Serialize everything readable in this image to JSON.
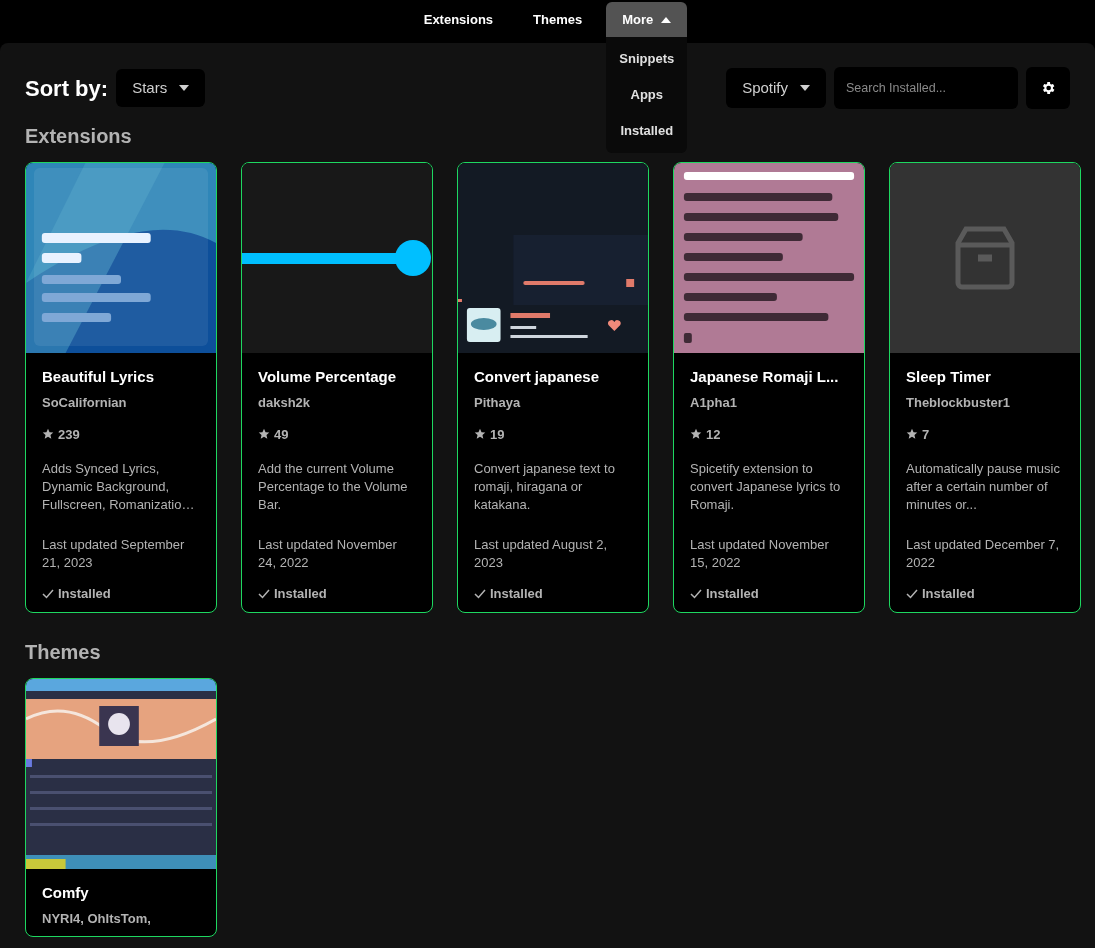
{
  "nav": {
    "tabs": [
      {
        "label": "Extensions",
        "selected": false
      },
      {
        "label": "Themes",
        "selected": false
      },
      {
        "label": "More",
        "selected": true,
        "expanded": true
      }
    ],
    "menu": [
      "Snippets",
      "Apps",
      "Installed"
    ]
  },
  "toolbar": {
    "sort_label": "Sort by:",
    "sort_value": "Stars",
    "repo_value": "Spotify",
    "search": {
      "placeholder": "Search Installed..."
    }
  },
  "sections": [
    {
      "title": "Extensions",
      "cards": [
        {
          "preview": {
            "kind": "lyrics"
          },
          "title": "Beautiful Lyrics",
          "author": "SoCalifornian",
          "star_count": "239",
          "description": "Adds Synced Lyrics, Dynamic Background, Fullscreen, Romanizatio…",
          "updated": "Last updated September 21, 2023",
          "installed": true,
          "status": "Installed"
        },
        {
          "preview": {
            "kind": "slider"
          },
          "title": "Volume Percentage",
          "author": "daksh2k",
          "star_count": "49",
          "description": "Add the current Volume Percentage to the Volume Bar.",
          "updated": "Last updated November 24, 2022",
          "installed": true,
          "status": "Installed"
        },
        {
          "preview": {
            "kind": "player"
          },
          "title": "Convert japanese",
          "author": "Pithaya",
          "star_count": "19",
          "description": "Convert japanese text to romaji, hiragana or katakana.",
          "updated": "Last updated August 2, 2023",
          "installed": true,
          "status": "Installed"
        },
        {
          "preview": {
            "kind": "romaji"
          },
          "title": "Japanese Romaji L...",
          "author": "A1pha1",
          "star_count": "12",
          "description": "Spicetify extension to convert Japanese lyrics to Romaji.",
          "updated": "Last updated November 15, 2022",
          "installed": true,
          "status": "Installed"
        },
        {
          "preview": {
            "kind": "placeholder"
          },
          "title": "Sleep Timer",
          "author": "Theblockbuster1",
          "star_count": "7",
          "description": "Automatically pause music after a certain number of minutes or...",
          "updated": "Last updated December 7, 2022",
          "installed": true,
          "status": "Installed"
        }
      ]
    },
    {
      "title": "Themes",
      "cards": [
        {
          "preview": {
            "kind": "theme"
          },
          "title": "Comfy",
          "author": "NYRI4, OhItsTom,"
        }
      ]
    }
  ]
}
